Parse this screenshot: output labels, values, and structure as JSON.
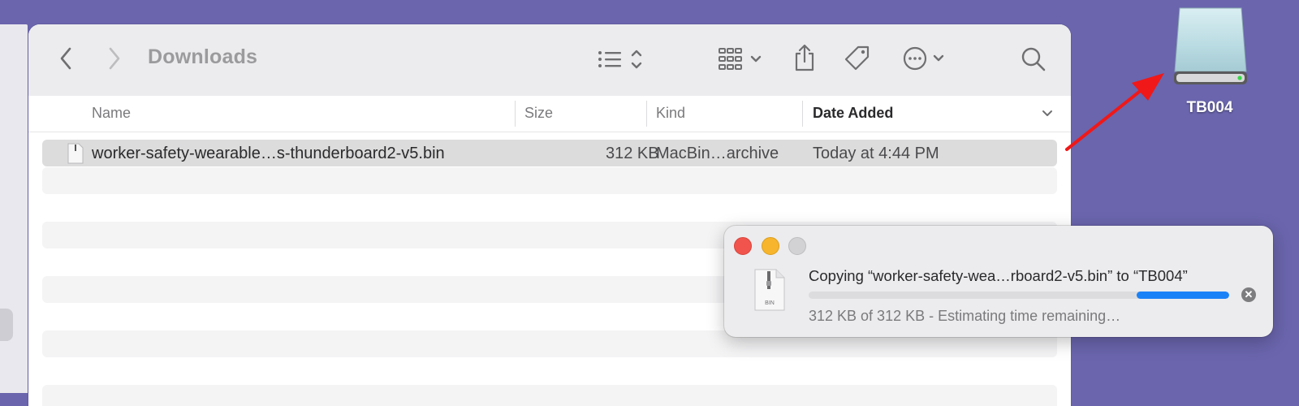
{
  "desktop": {
    "drive_label": "TB004"
  },
  "finder": {
    "title": "Downloads",
    "columns": {
      "name": "Name",
      "size": "Size",
      "kind": "Kind",
      "date_added": "Date Added"
    },
    "files": [
      {
        "name": "worker-safety-wearable…s-thunderboard2-v5.bin",
        "size": "312 KB",
        "kind": "MacBin…archive",
        "date_added": "Today at 4:44 PM"
      }
    ]
  },
  "copy_dialog": {
    "message": "Copying “worker-safety-wea…rboard2-v5.bin” to “TB004”",
    "status": "312 KB of 312 KB - Estimating time remaining…",
    "file_icon_label": "BIN",
    "progress": 0.22
  },
  "colors": {
    "desktop": "#6a65ad",
    "accent": "#1a82f7",
    "close": "#f0544c",
    "minimize": "#f6b52c",
    "zoom_disabled": "#d2d2d4",
    "arrow": "#f01818"
  },
  "icons": {
    "back": "chevron-left-icon",
    "forward": "chevron-right-icon",
    "view": "list-view-icon",
    "group": "grid-group-icon",
    "share": "share-icon",
    "tag": "tag-icon",
    "more": "ellipsis-circle-icon",
    "search": "search-icon"
  }
}
